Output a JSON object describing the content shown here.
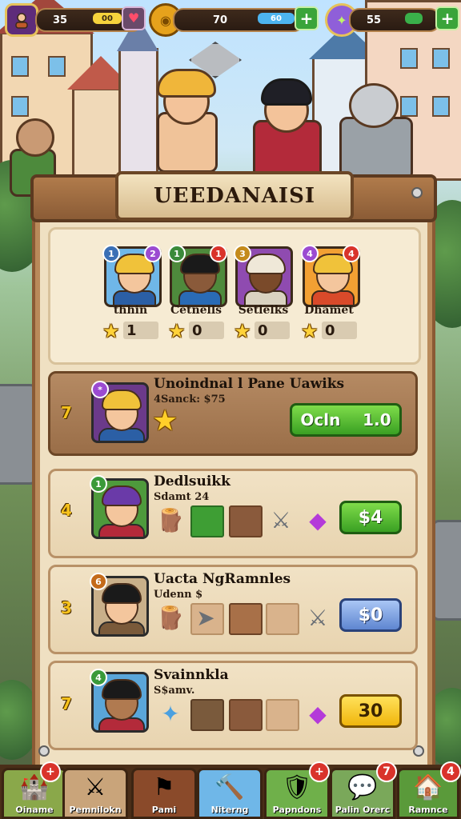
{
  "hud": {
    "level": "35",
    "xp_pill": "00",
    "gold": "70",
    "gold_pill": "60",
    "gems": "55"
  },
  "title": "UEEDANAISI",
  "team": [
    {
      "name": "thhin",
      "stars": "1",
      "badge_left": "1",
      "badge_right": "2",
      "bg": "#6fb7e8"
    },
    {
      "name": "Cetnells",
      "stars": "0",
      "badge_left": "1",
      "badge_right": "1",
      "bg": "#4e8a3c"
    },
    {
      "name": "Setlelks",
      "stars": "0",
      "badge_left": "3",
      "badge_right": "",
      "bg": "#8f4bb0"
    },
    {
      "name": "Dhamet",
      "stars": "0",
      "badge_left": "4",
      "badge_right": "4",
      "bg": "#f2a033"
    }
  ],
  "rows": [
    {
      "num": "7",
      "title": "Unoindnal l Pane Uawiks",
      "sub": "4Sanck: $75",
      "button": "Ocln    1.0",
      "badge": "*"
    },
    {
      "num": "4",
      "title": "Dedlsuikk",
      "sub": "Sdamt 24",
      "button": "$4",
      "badge": "1"
    },
    {
      "num": "3",
      "title": "Uacta NgRamnles",
      "sub": "Udenn $",
      "button": "$0",
      "badge": "6"
    },
    {
      "num": "7",
      "title": "Svainnkla",
      "sub": "S$amv.",
      "button": "30",
      "badge": "4"
    }
  ],
  "nav": [
    {
      "label": "Oiname",
      "badge": "+"
    },
    {
      "label": "Pemnilokn",
      "badge": ""
    },
    {
      "label": "Pami",
      "badge": ""
    },
    {
      "label": "Niterng",
      "badge": ""
    },
    {
      "label": "Papndons",
      "badge": "+"
    },
    {
      "label": "Palin Orerc",
      "badge": "7"
    },
    {
      "label": "Ramnce",
      "badge": "4"
    }
  ],
  "colors": {
    "panel": "#efe0c2",
    "wood": "#8a5a34",
    "accent_green": "#3aa023",
    "accent_gold": "#ffd23a"
  }
}
